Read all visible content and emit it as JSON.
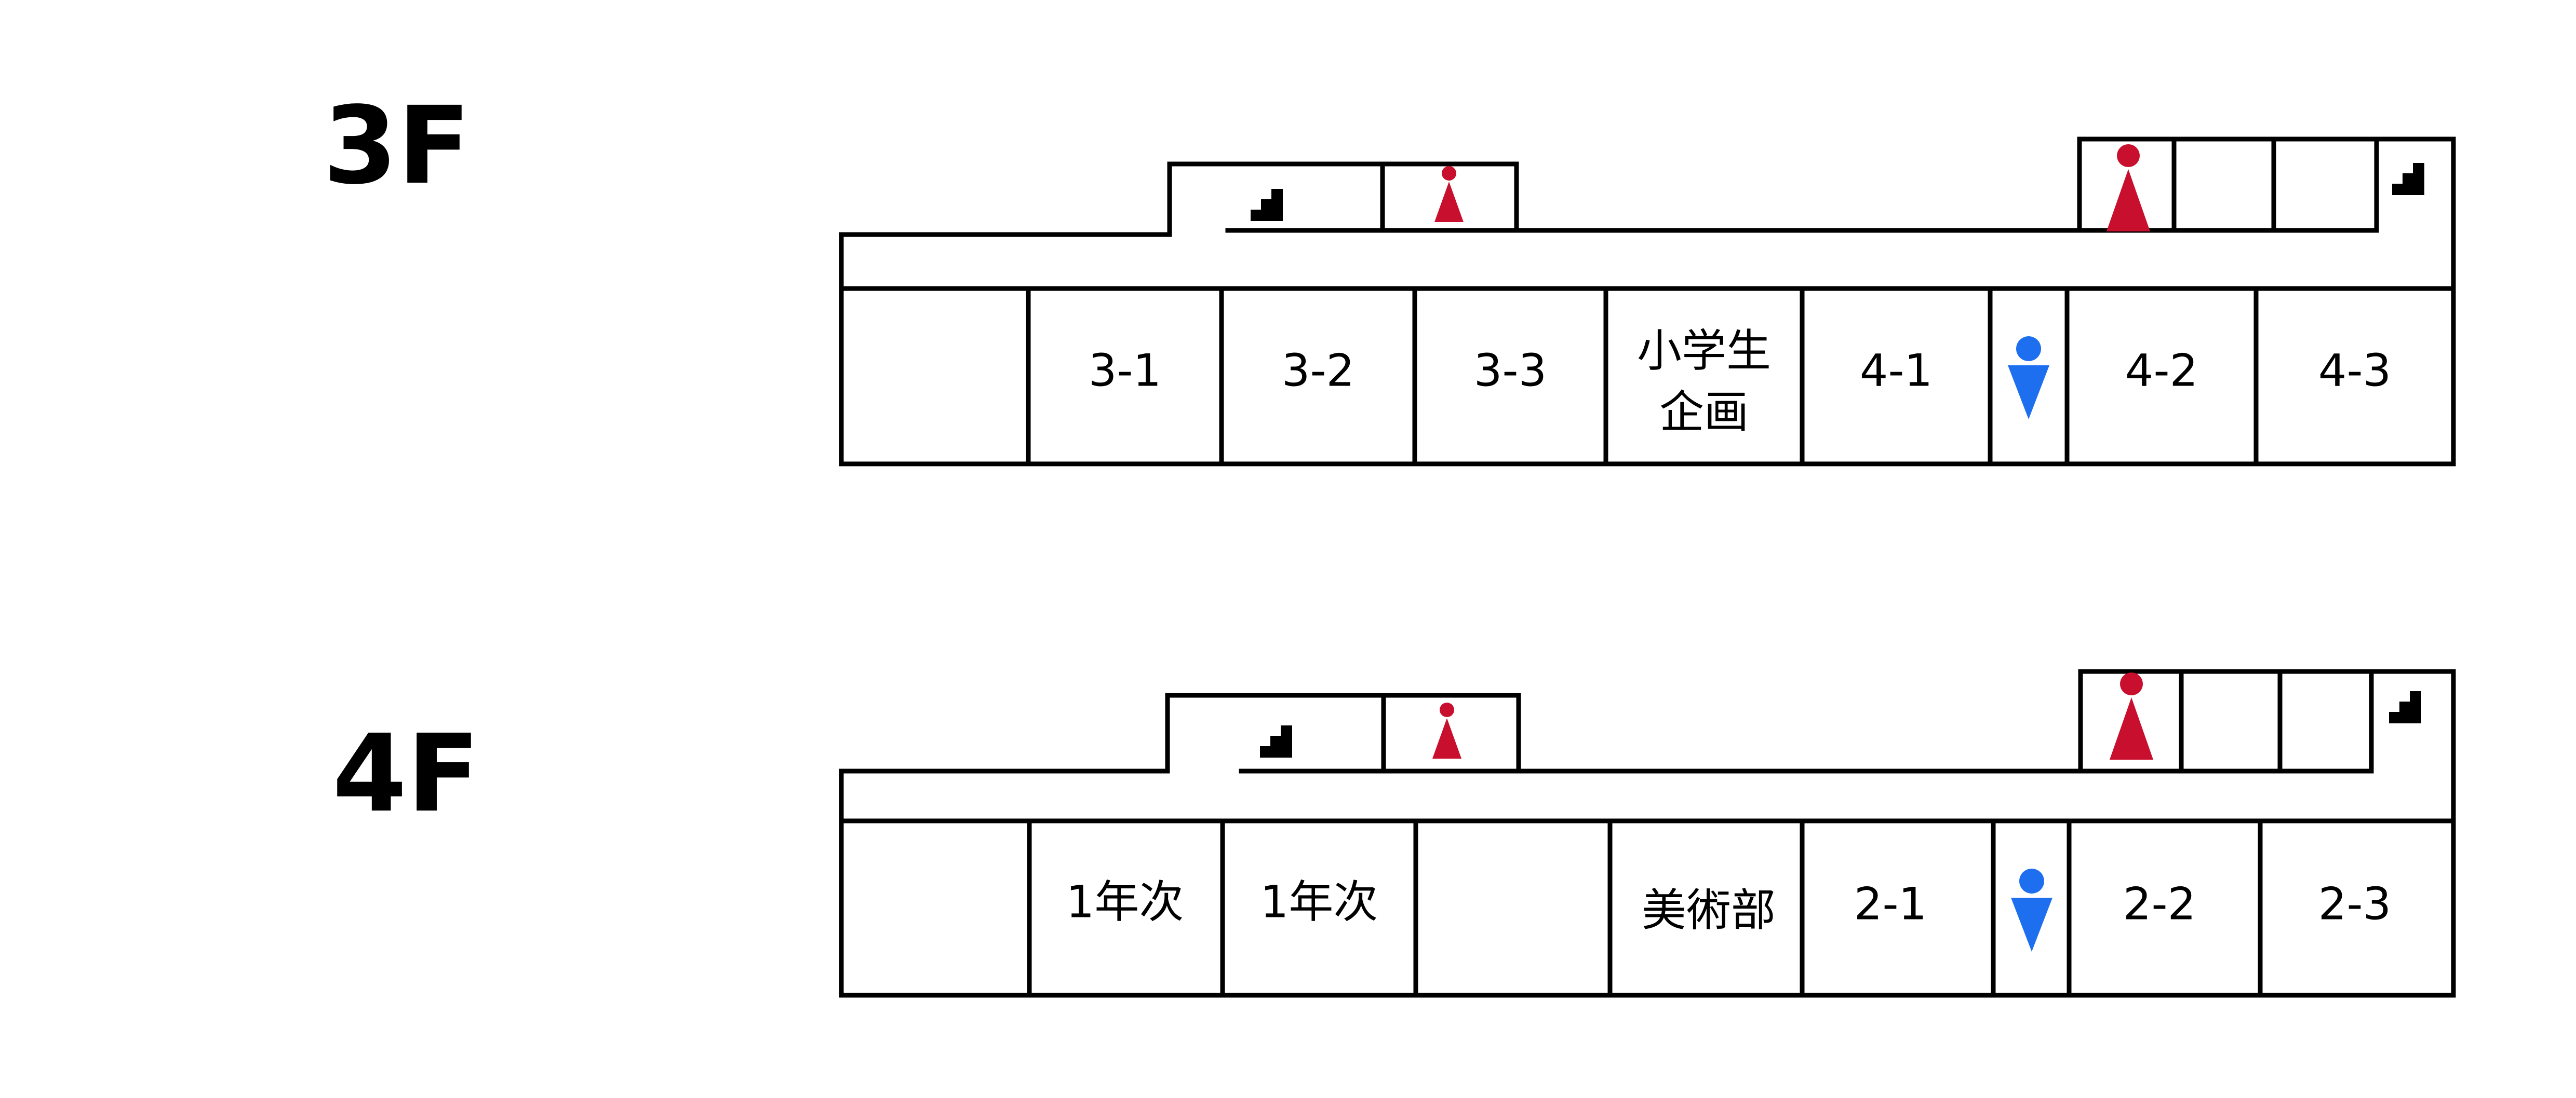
{
  "colors": {
    "wall": "#000000",
    "women": "#c8102e",
    "men": "#1e6ff0",
    "background": "#ffffff"
  },
  "floors": [
    {
      "label": "3F",
      "rooms": [
        {
          "lines": []
        },
        {
          "lines": [
            "3-1"
          ]
        },
        {
          "lines": [
            "3-2"
          ]
        },
        {
          "lines": [
            "3-3"
          ]
        },
        {
          "lines": [
            "小学生",
            "企画"
          ]
        },
        {
          "lines": [
            "4-1"
          ]
        },
        {
          "icon": "men-restroom-icon"
        },
        {
          "lines": [
            "4-2"
          ]
        },
        {
          "lines": [
            "4-3"
          ]
        }
      ],
      "top_left_block": [
        "stairs-icon",
        "women-restroom-icon"
      ],
      "top_right_block": [
        "women-restroom-icon",
        "",
        "",
        "stairs-icon"
      ]
    },
    {
      "label": "4F",
      "rooms": [
        {
          "lines": []
        },
        {
          "lines": [
            "1年次"
          ]
        },
        {
          "lines": [
            "1年次"
          ]
        },
        {
          "lines": []
        },
        {
          "lines": [
            "美術部"
          ]
        },
        {
          "lines": [
            "2-1"
          ]
        },
        {
          "icon": "men-restroom-icon"
        },
        {
          "lines": [
            "2-2"
          ]
        },
        {
          "lines": [
            "2-3"
          ]
        }
      ],
      "top_left_block": [
        "stairs-icon",
        "women-restroom-icon"
      ],
      "top_right_block": [
        "women-restroom-icon",
        "",
        "",
        "stairs-icon"
      ]
    }
  ]
}
